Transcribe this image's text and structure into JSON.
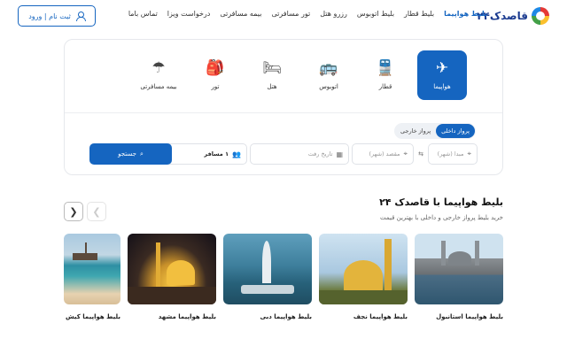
{
  "header": {
    "logo_text": "قاصدک۲۴",
    "nav": [
      {
        "label": "بلیط هواپیما",
        "active": true
      },
      {
        "label": "بلیط قطار",
        "active": false
      },
      {
        "label": "بلیط اتوبوس",
        "active": false
      },
      {
        "label": "رزرو هتل",
        "active": false
      },
      {
        "label": "تور مسافرتی",
        "active": false
      },
      {
        "label": "بیمه مسافرتی",
        "active": false
      },
      {
        "label": "درخواست ویزا",
        "active": false
      },
      {
        "label": "تماس باما",
        "active": false
      }
    ],
    "login_label": "ثبت نام | ورود"
  },
  "search": {
    "tabs": [
      {
        "label": "هواپیما",
        "icon": "airplane-icon",
        "active": true
      },
      {
        "label": "قطار",
        "icon": "train-icon",
        "active": false
      },
      {
        "label": "اتوبوس",
        "icon": "bus-icon",
        "active": false
      },
      {
        "label": "هتل",
        "icon": "bed-icon",
        "active": false
      },
      {
        "label": "تور",
        "icon": "backpack-icon",
        "active": false
      },
      {
        "label": "بیمه مسافرتی",
        "icon": "umbrella-icon",
        "active": false
      }
    ],
    "toggle": {
      "domestic": "پرواز داخلی",
      "international": "پرواز خارجی",
      "selected": "domestic"
    },
    "origin_placeholder": "مبدا (شهر)",
    "destination_placeholder": "مقصد (شهر)",
    "date_placeholder": "تاریخ رفت",
    "passengers_value": "۱ مسافر",
    "search_button": "جستجو"
  },
  "section": {
    "title": "بلیط هواپیما با قاصدک ۲۴",
    "subtitle": "خرید بلیط پرواز خارجی و داخلی با بهترین قیمت",
    "destinations": [
      {
        "label": "بلیط هواپیما استانبول",
        "image": "istanbul"
      },
      {
        "label": "بلیط هواپیما نجف",
        "image": "najaf"
      },
      {
        "label": "بلیط هواپیما دبی",
        "image": "dubai"
      },
      {
        "label": "بلیط هواپیما مشهد",
        "image": "mashhad"
      },
      {
        "label": "بلیط هواپیما کیش",
        "image": "kish"
      }
    ]
  },
  "colors": {
    "primary": "#1565c0",
    "card_border": "#e6e8ec",
    "text": "#222222"
  }
}
